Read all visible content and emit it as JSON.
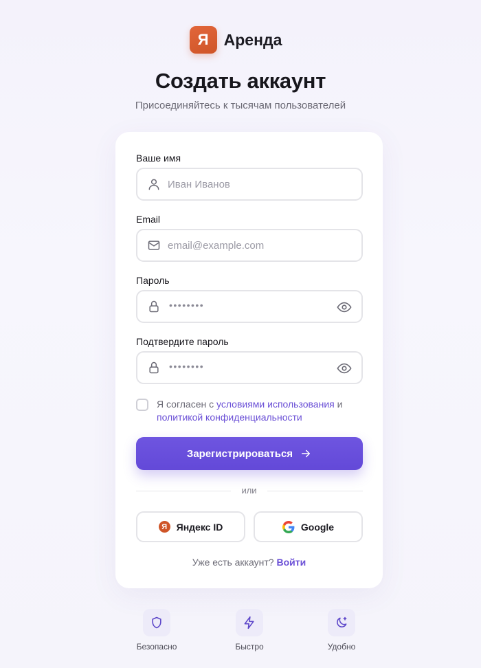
{
  "brand": {
    "logo_letter": "Я",
    "name": "Аренда",
    "logo_color": "#cf5528"
  },
  "header": {
    "title": "Создать аккаунт",
    "subtitle": "Присоединяйтесь к тысячам пользователей"
  },
  "form": {
    "name": {
      "label": "Ваше имя",
      "placeholder": "Иван Иванов",
      "icon": "user-icon"
    },
    "email": {
      "label": "Email",
      "placeholder": "email@example.com",
      "icon": "mail-icon"
    },
    "password": {
      "label": "Пароль",
      "masked_value": "••••••••",
      "icon": "lock-icon",
      "toggle_icon": "eye-icon"
    },
    "confirm_password": {
      "label": "Подтвердите пароль",
      "masked_value": "••••••••",
      "icon": "lock-icon",
      "toggle_icon": "eye-icon"
    },
    "agreement": {
      "text_before": "Я согласен с ",
      "terms_link": "условиями использования",
      "text_middle": " и ",
      "privacy_link": "политикой конфиденциальности",
      "checked": false
    },
    "submit_label": "Зарегистрироваться",
    "submit_icon": "arrow-right-icon",
    "divider_text": "или",
    "social": {
      "yandex_label": "Яндекс ID",
      "yandex_badge": "Я",
      "google_label": "Google"
    },
    "login_prompt": "Уже есть аккаунт?",
    "login_link": "Войти"
  },
  "features": [
    {
      "label": "Безопасно",
      "icon": "shield-icon"
    },
    {
      "label": "Быстро",
      "icon": "lightning-icon"
    },
    {
      "label": "Удобно",
      "icon": "moon-star-icon"
    }
  ],
  "colors": {
    "accent": "#6349d8",
    "link": "#6a4fd6",
    "brand_orange": "#cf5528",
    "card_bg": "#ffffff",
    "page_bg": "#f5f4fb"
  }
}
